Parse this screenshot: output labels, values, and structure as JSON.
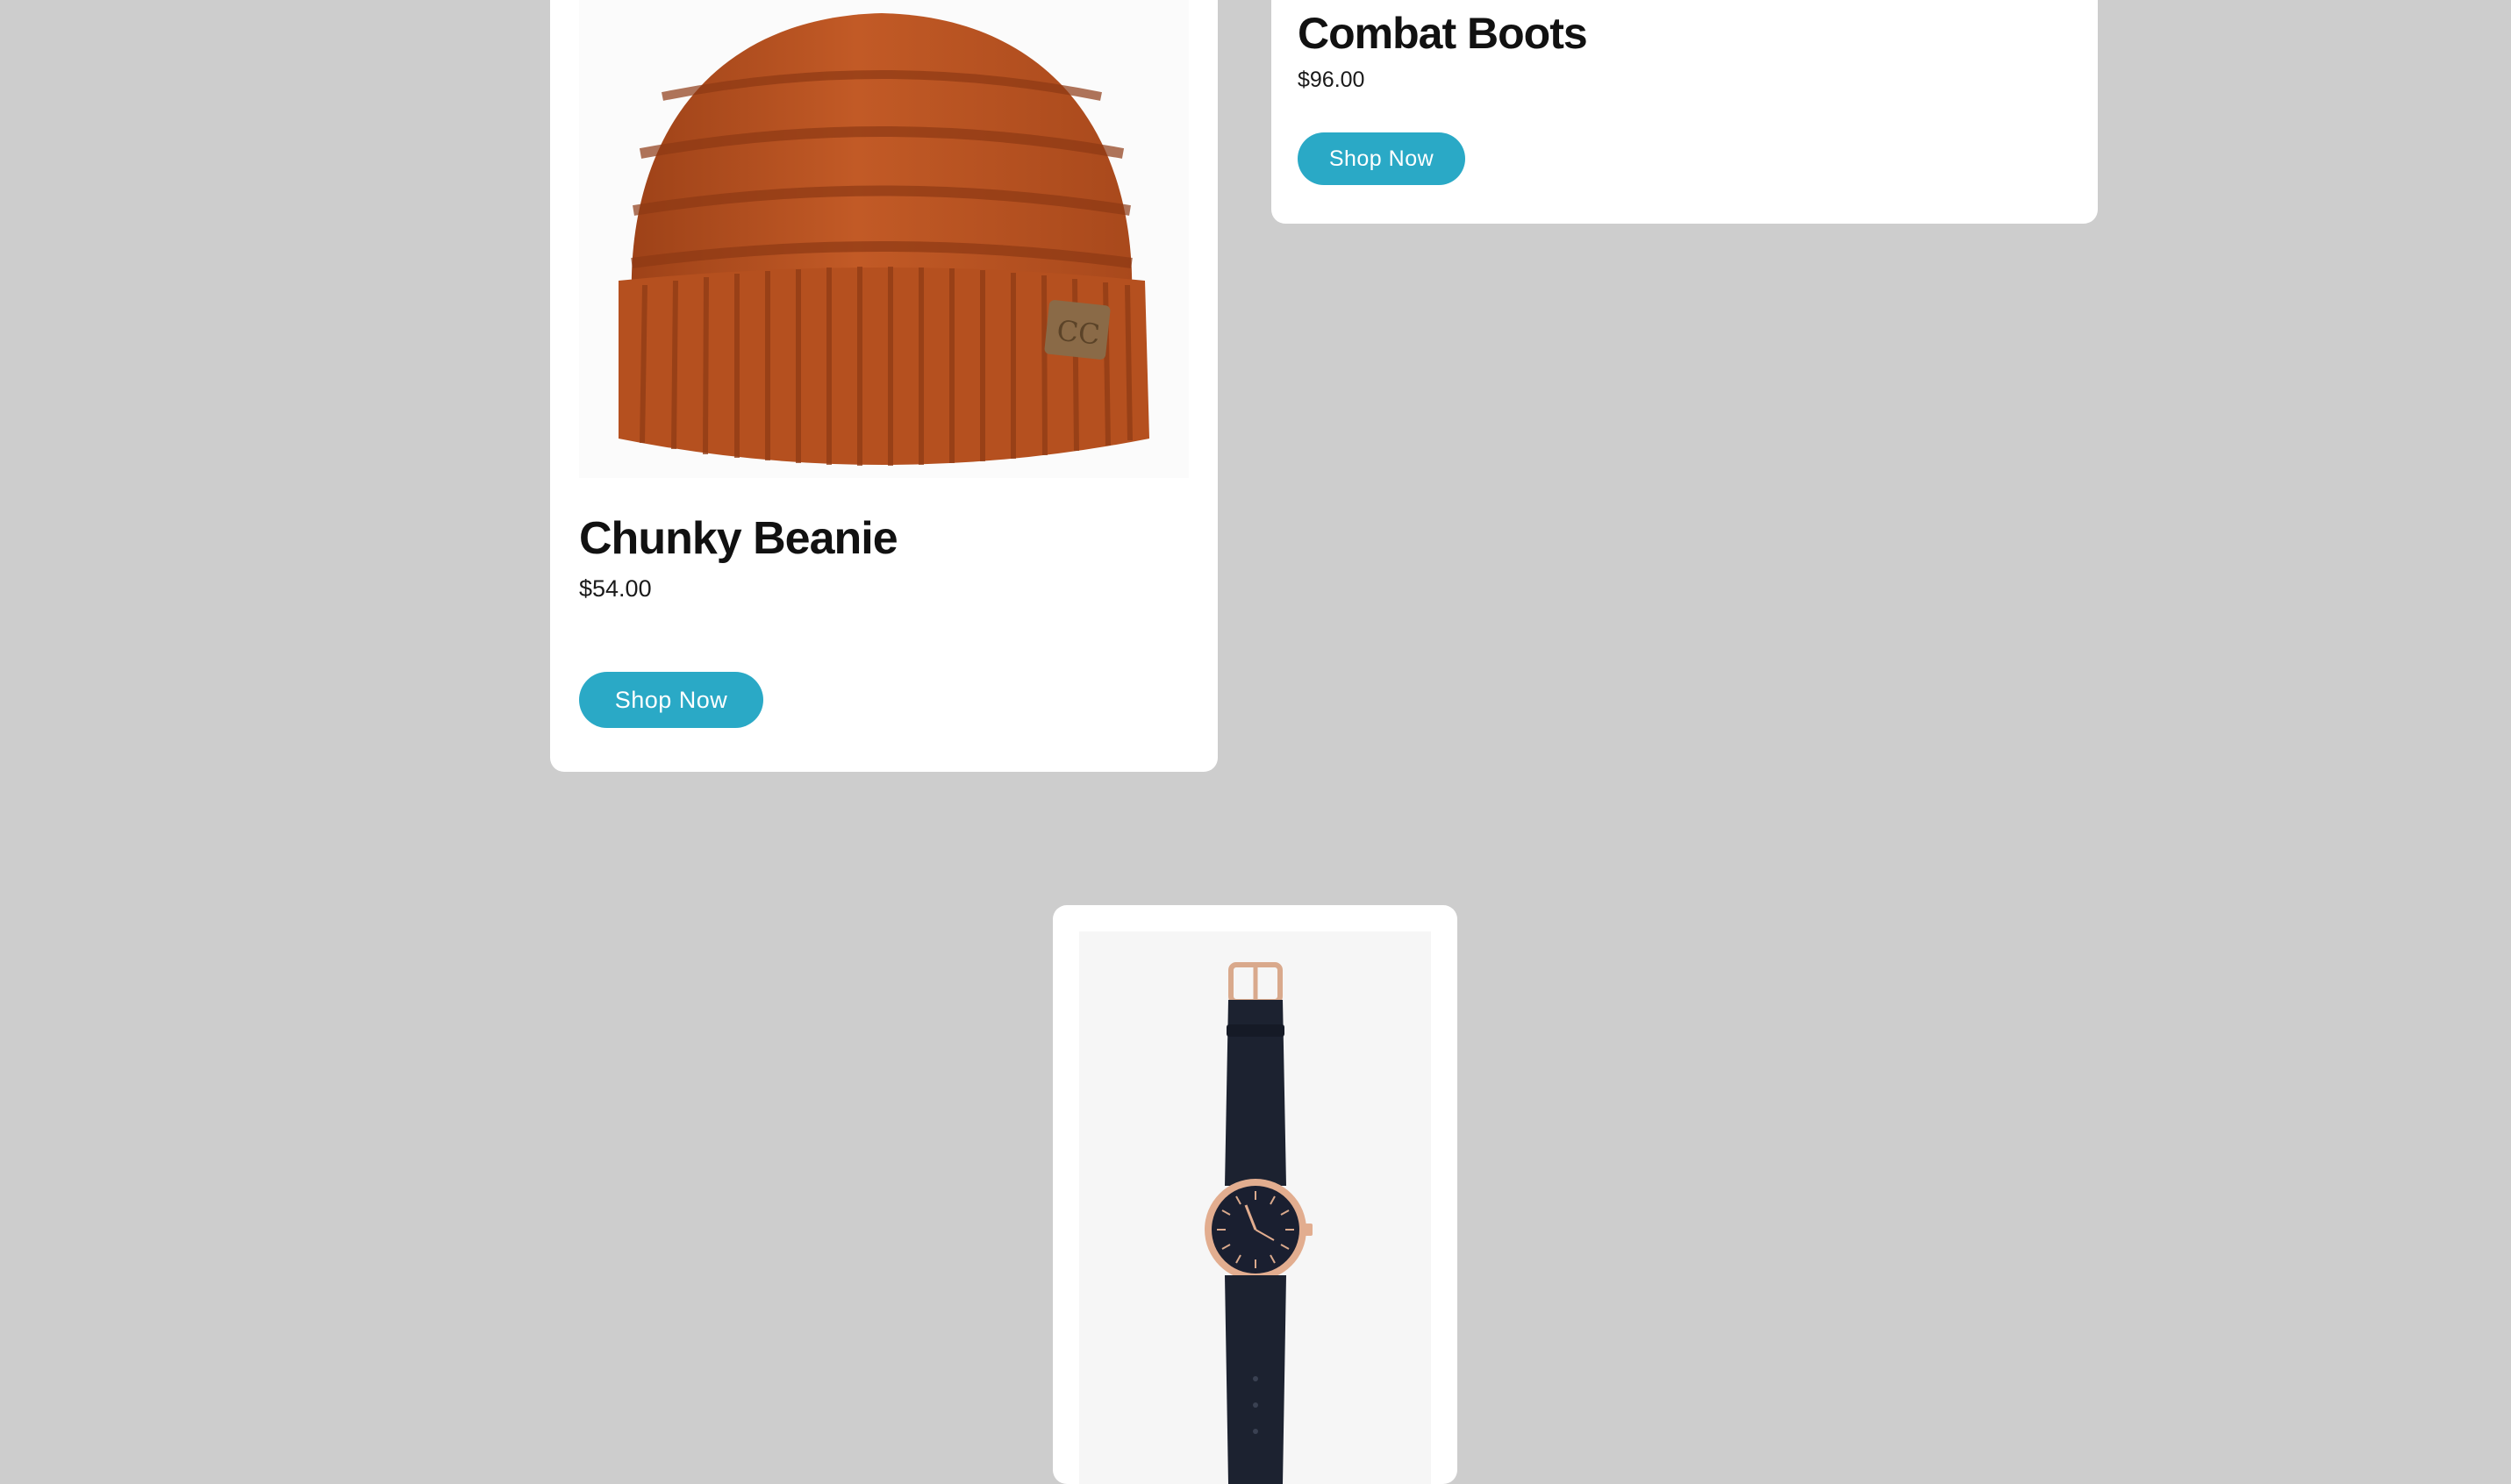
{
  "products": [
    {
      "name": "Chunky Beanie",
      "price": "$54.00",
      "cta": "Shop Now",
      "image_icon": "beanie-photo",
      "image_color": "#b8501f"
    },
    {
      "name": "Combat Boots",
      "price": "$96.00",
      "cta": "Shop Now"
    },
    {
      "image_icon": "watch-photo"
    }
  ],
  "colors": {
    "page_background": "#cdcdcd",
    "card_background": "#ffffff",
    "button_accent": "#2aa9c6",
    "title_text": "#111111"
  }
}
